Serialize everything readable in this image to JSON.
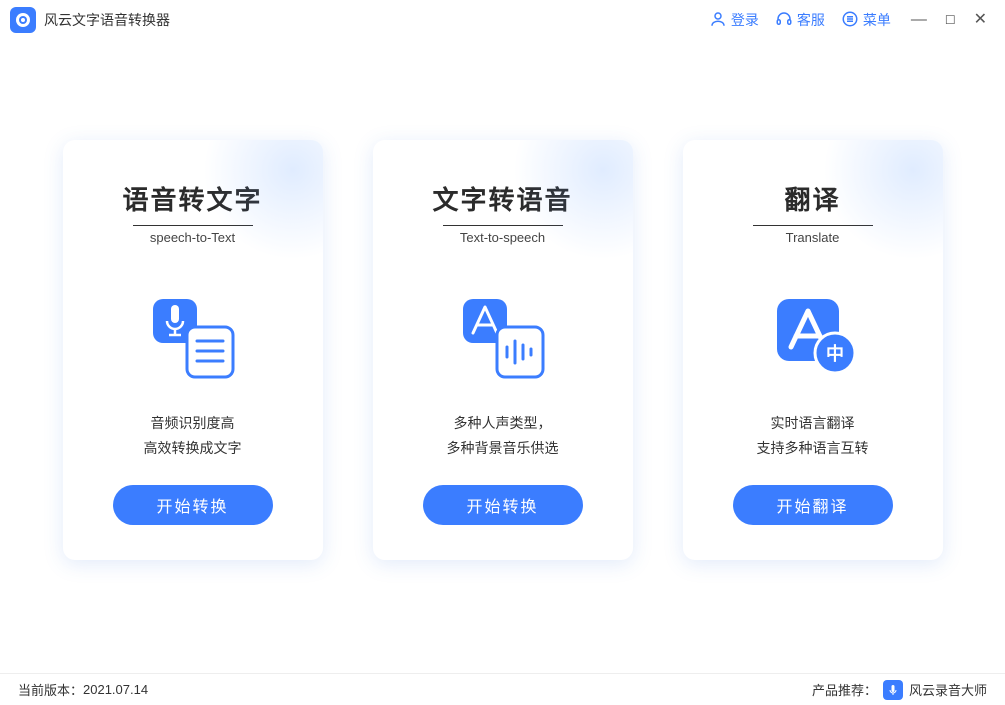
{
  "header": {
    "app_title": "风云文字语音转换器",
    "nav": {
      "login": "登录",
      "service": "客服",
      "menu": "菜单"
    }
  },
  "cards": [
    {
      "title": "语音转文字",
      "subtitle": "speech-to-Text",
      "desc": "音频识别度高\n高效转换成文字",
      "btn": "开始转换",
      "icon": "speech-to-text"
    },
    {
      "title": "文字转语音",
      "subtitle": "Text-to-speech",
      "desc": "多种人声类型，\n多种背景音乐供选",
      "btn": "开始转换",
      "icon": "text-to-speech"
    },
    {
      "title": "翻译",
      "subtitle": "Translate",
      "desc": "实时语言翻译\n支持多种语言互转",
      "btn": "开始翻译",
      "icon": "translate"
    }
  ],
  "footer": {
    "version_label": "当前版本：",
    "version_value": "2021.07.14",
    "recommend_label": "产品推荐：",
    "recommend_product": "风云录音大师"
  },
  "colors": {
    "accent": "#3b7dff"
  }
}
